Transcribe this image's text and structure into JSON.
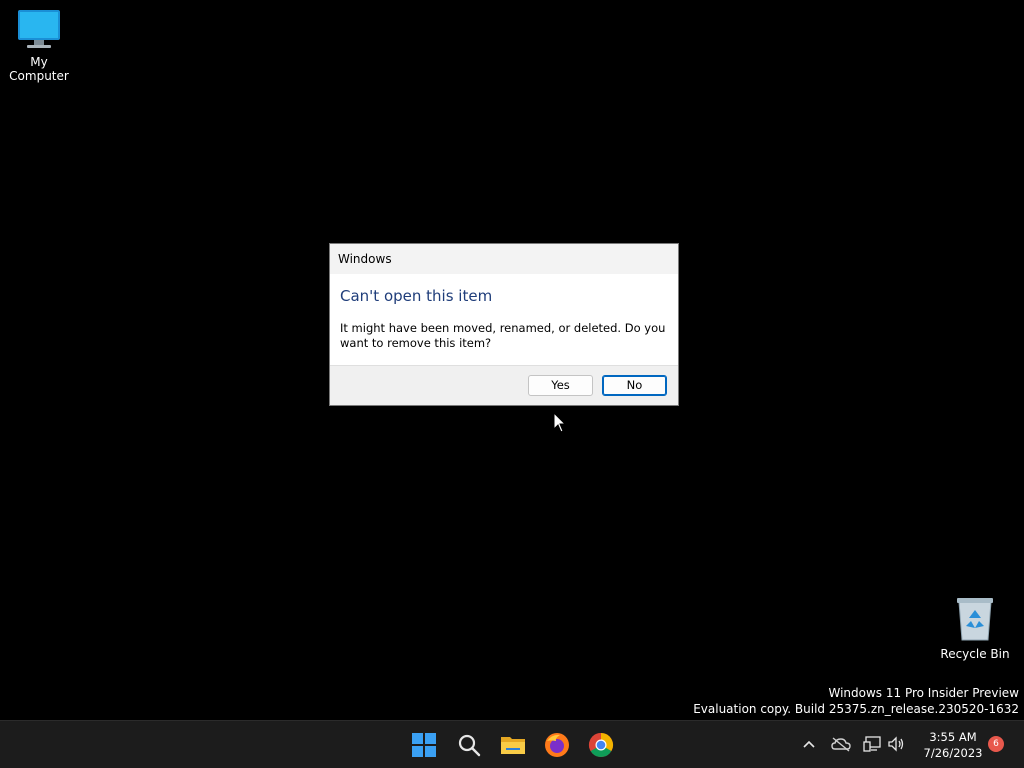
{
  "desktop": {
    "icons": [
      {
        "label": "My Computer",
        "icon": "monitor-icon"
      },
      {
        "label": "Recycle Bin",
        "icon": "recycle-bin-icon"
      }
    ],
    "watermark": {
      "line1": "Windows 11 Pro Insider Preview",
      "line2": "Evaluation copy. Build 25375.zn_release.230520-1632"
    }
  },
  "dialog": {
    "title": "Windows",
    "heading": "Can't open this item",
    "message": "It might have been moved, renamed, or deleted. Do you want to remove this item?",
    "buttons": {
      "yes": "Yes",
      "no": "No"
    },
    "heading_color": "#1f3d7a"
  },
  "taskbar": {
    "apps": [
      {
        "name": "Start",
        "icon": "windows-start-icon"
      },
      {
        "name": "Search",
        "icon": "search-icon"
      },
      {
        "name": "File Explorer",
        "icon": "folder-icon"
      },
      {
        "name": "Firefox",
        "icon": "firefox-icon"
      },
      {
        "name": "Chrome",
        "icon": "chrome-icon"
      }
    ],
    "tray": {
      "icons": [
        "chevron-up-icon",
        "onedrive-offline-icon",
        "network-icon",
        "volume-icon"
      ],
      "time": "3:55 AM",
      "date": "7/26/2023",
      "notification_count": "6"
    }
  }
}
